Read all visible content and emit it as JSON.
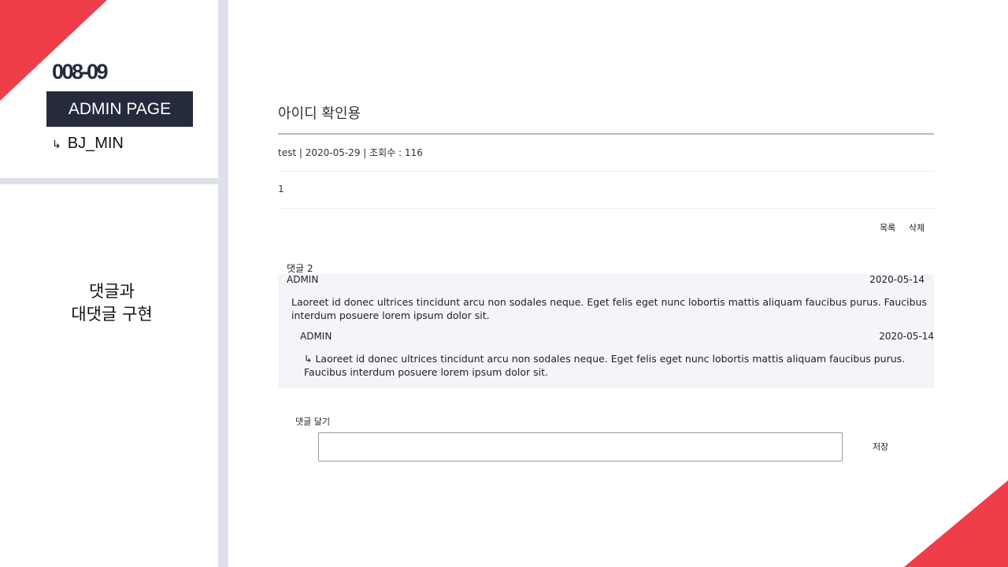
{
  "slide": {
    "code": "008-09",
    "badge": "ADMIN PAGE",
    "sub_arrow": "↳",
    "sub_label": "BJ_MIN",
    "caption_line1": "댓글과",
    "caption_line2": "대댓글 구현"
  },
  "post": {
    "title": "아이디 확인용",
    "meta": "test | 2020-05-29 | 조회수 : 116",
    "body": "1"
  },
  "actions": {
    "list": "목록",
    "delete": "삭제"
  },
  "comments": {
    "count_label": "댓글 2",
    "items": [
      {
        "author": "ADMIN",
        "date": "2020-05-14",
        "text": "Laoreet id donec ultrices tincidunt arcu non sodales neque. Eget felis eget nunc lobortis mattis aliquam faucibus purus. Faucibus interdum posuere lorem ipsum dolor sit."
      },
      {
        "author": "ADMIN",
        "date": "2020-05-14",
        "text": "↳ Laoreet id donec ultrices tincidunt arcu non sodales neque. Eget felis eget nunc lobortis mattis aliquam faucibus purus. Faucibus interdum posuere lorem ipsum dolor sit."
      }
    ]
  },
  "reply_form": {
    "label": "댓글 달기",
    "value": "",
    "save": "저장"
  },
  "colors": {
    "accent": "#ef3e4a",
    "navy": "#262a3d",
    "divider": "#dfe1ea",
    "comment_bg": "#f3f5f8"
  }
}
